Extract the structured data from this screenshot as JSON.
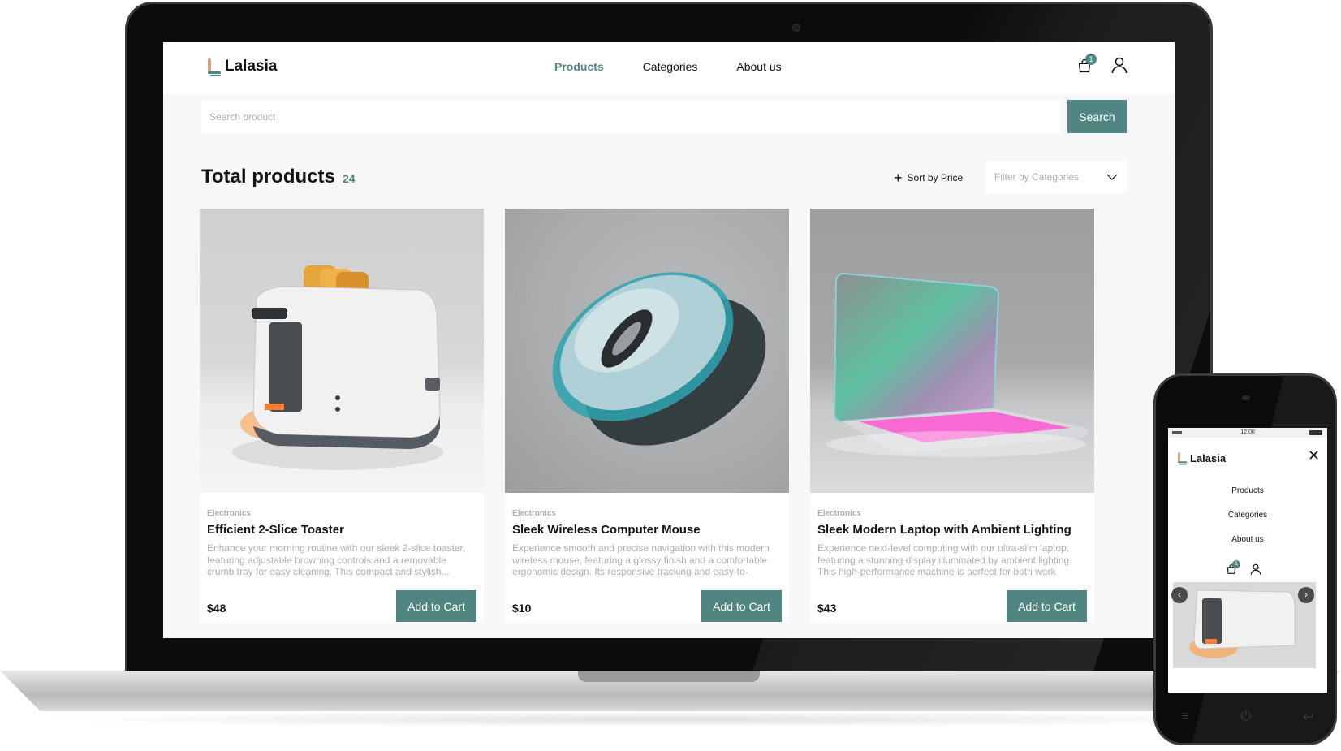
{
  "app": {
    "brand": "Lalasia",
    "accent_color": "#518581",
    "text_color": "#151411",
    "muted_color": "#afadb5"
  },
  "header": {
    "nav": [
      {
        "label": "Products",
        "active": true
      },
      {
        "label": "Categories",
        "active": false
      },
      {
        "label": "About us",
        "active": false
      }
    ],
    "cart_icon": "shopping-bag-icon",
    "cart_count": "1",
    "user_icon": "user-icon"
  },
  "search": {
    "placeholder": "Search product",
    "button_label": "Search"
  },
  "toolbar": {
    "title": "Total products",
    "count": "24",
    "sort_label": "Sort by Price",
    "filter_placeholder": "Filter by Categories"
  },
  "products": [
    {
      "category": "Electronics",
      "title": "Efficient 2-Slice Toaster",
      "description": "Enhance your morning routine with our sleek 2-slice toaster, featuring adjustable browning controls and a removable crumb tray for easy cleaning. This compact and stylish...",
      "price": "$48",
      "button_label": "Add to Cart"
    },
    {
      "category": "Electronics",
      "title": "Sleek Wireless Computer Mouse",
      "description": "Experience smooth and precise navigation with this modern wireless mouse, featuring a glossy finish and a comfortable ergonomic design. Its responsive tracking and easy-to-use...",
      "price": "$10",
      "button_label": "Add to Cart"
    },
    {
      "category": "Electronics",
      "title": "Sleek Modern Laptop with Ambient Lighting",
      "description": "Experience next-level computing with our ultra-slim laptop, featuring a stunning display illuminated by ambient lighting. This high-performance machine is perfect for both work and...",
      "price": "$43",
      "button_label": "Add to Cart"
    }
  ],
  "mobile": {
    "status_time": "12:00",
    "brand": "Lalasia",
    "close_icon": "close-icon",
    "menu": [
      "Products",
      "Categories",
      "About us"
    ],
    "cart_count": "1",
    "prev_icon": "chevron-left-icon",
    "next_icon": "chevron-right-icon"
  }
}
